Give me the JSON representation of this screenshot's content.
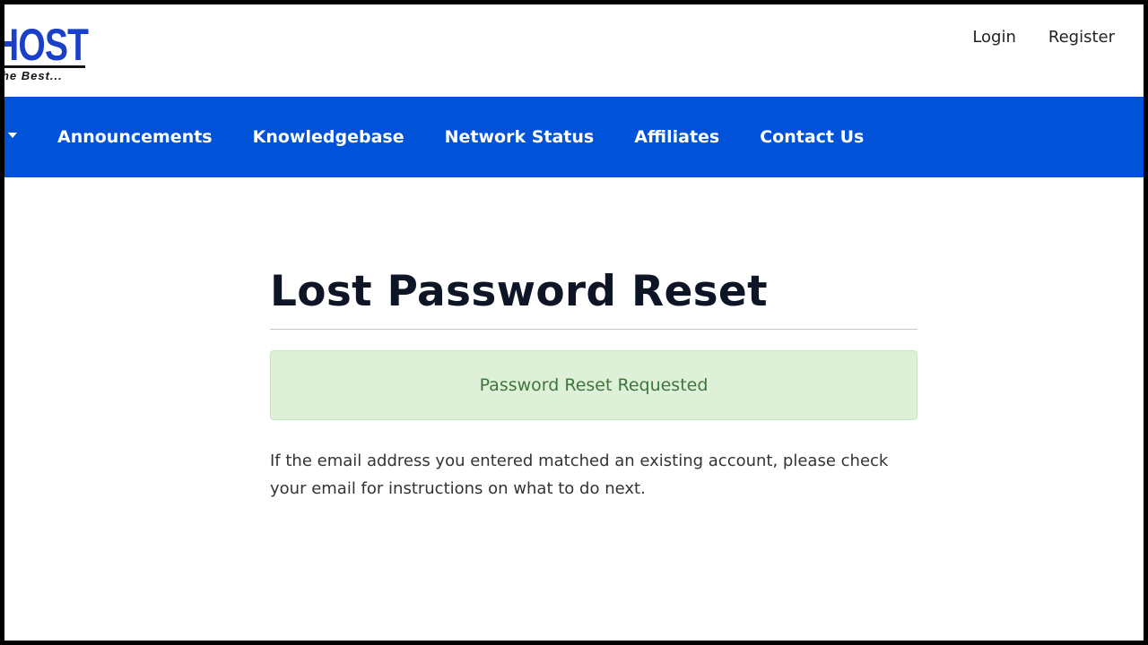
{
  "logo": {
    "main_text": "HOST",
    "tagline": "The Best..."
  },
  "header": {
    "links": [
      "Login",
      "Register"
    ]
  },
  "nav": {
    "items": [
      "Announcements",
      "Knowledgebase",
      "Network Status",
      "Affiliates",
      "Contact Us"
    ]
  },
  "main": {
    "title": "Lost Password Reset",
    "alert": "Password Reset Requested",
    "message": "If the email address you entered matched an existing account, please check your email for instructions on what to do next."
  },
  "colors": {
    "navbar_background": "#0052d9",
    "logo_blue": "#1a3fc9",
    "alert_background": "#dff0d8",
    "alert_text": "#3c763d"
  }
}
